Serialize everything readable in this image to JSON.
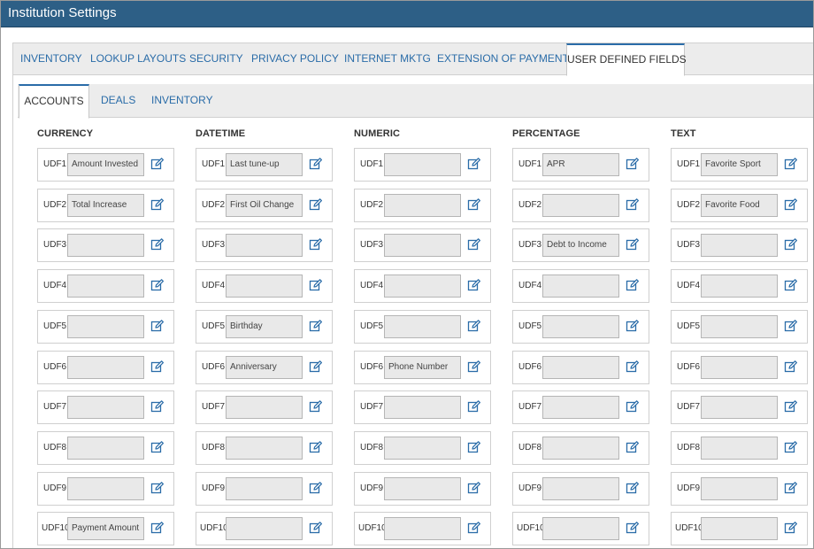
{
  "window": {
    "title": "Institution Settings"
  },
  "tabs_main": [
    "INVENTORY",
    "LOOKUP LAYOUTS",
    "SECURITY",
    "PRIVACY POLICY",
    "INTERNET MKTG",
    "EXTENSION OF PAYMENTS",
    "USER DEFINED FIELDS"
  ],
  "tabs_sub": [
    "ACCOUNTS",
    "DEALS",
    "INVENTORY"
  ],
  "udf_labels": [
    "UDF1",
    "UDF2",
    "UDF3",
    "UDF4",
    "UDF5",
    "UDF6",
    "UDF7",
    "UDF8",
    "UDF9",
    "UDF10"
  ],
  "columns": [
    {
      "header": "CURRENCY",
      "values": [
        "Amount Invested",
        "Total Increase",
        "",
        "",
        "",
        "",
        "",
        "",
        "",
        "Payment Amount"
      ]
    },
    {
      "header": "DATETIME",
      "values": [
        "Last tune-up",
        "First Oil Change",
        "",
        "",
        "Birthday",
        "Anniversary",
        "",
        "",
        "",
        ""
      ]
    },
    {
      "header": "NUMERIC",
      "values": [
        "",
        "",
        "",
        "",
        "",
        "Phone Number",
        "",
        "",
        "",
        ""
      ]
    },
    {
      "header": "PERCENTAGE",
      "values": [
        "APR",
        "",
        "Debt to Income",
        "",
        "",
        "",
        "",
        "",
        "",
        ""
      ]
    },
    {
      "header": "TEXT",
      "values": [
        "Favorite Sport",
        "Favorite Food",
        "",
        "",
        "",
        "",
        "",
        "",
        "",
        ""
      ]
    }
  ],
  "colors": {
    "titlebar": "#2d5f86",
    "accent": "#2a6ca8",
    "input_bg": "#e9e9e9"
  },
  "icons": {
    "edit": "edit-icon"
  }
}
